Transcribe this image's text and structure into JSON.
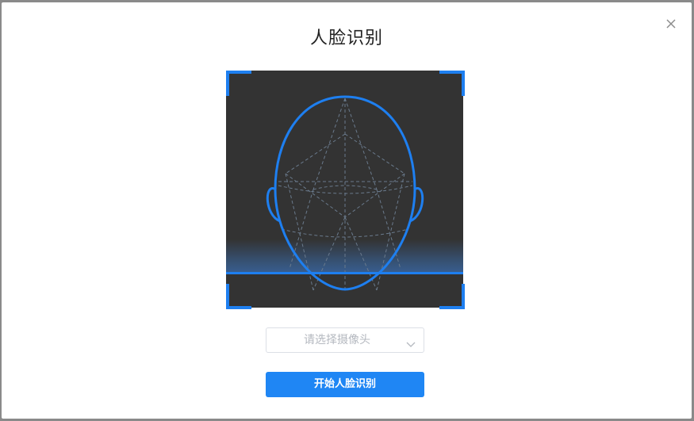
{
  "dialog": {
    "title": "人脸识别",
    "close_icon": "close-icon"
  },
  "camera_view": {
    "overlay_icon": "face-outline-icon",
    "accent_color": "#1e7ff0",
    "background_color": "#333333"
  },
  "camera_select": {
    "placeholder": "请选择摄像头",
    "icon": "chevron-down-icon"
  },
  "start_button": {
    "label": "开始人脸识别",
    "color": "#1f86f4"
  }
}
